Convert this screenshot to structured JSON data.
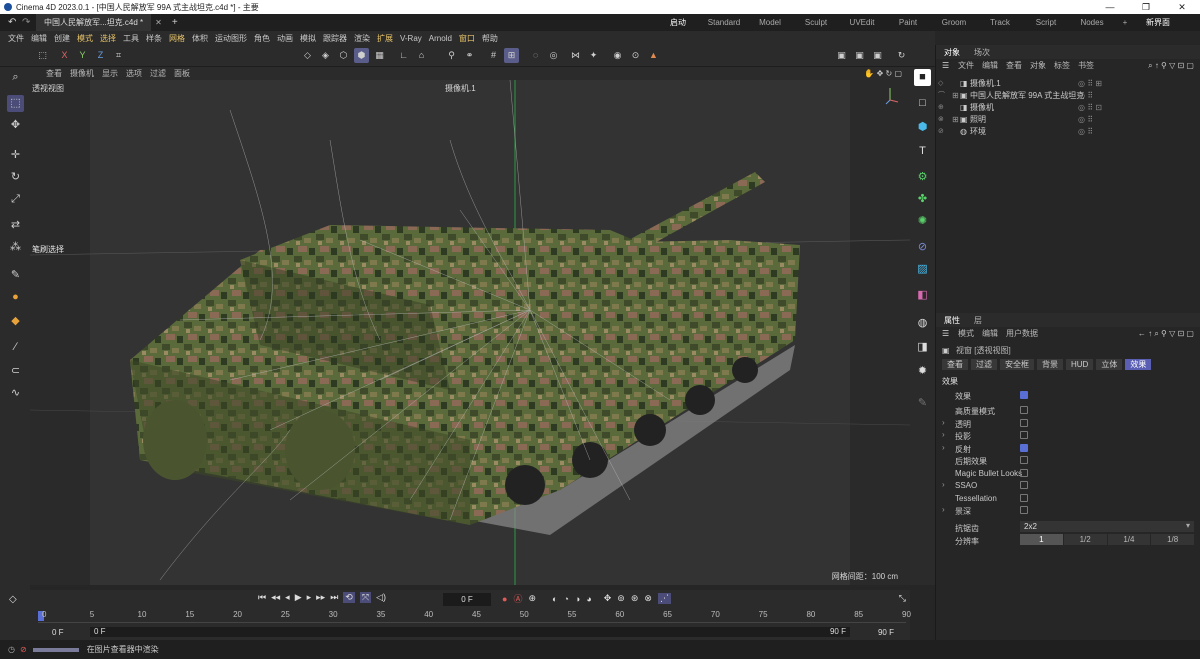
{
  "titlebar": {
    "title": "Cinema 4D 2023.0.1 - [中国人民解放军 99A 式主战坦克.c4d *] - 主要",
    "min": "—",
    "max": "❐",
    "close": "✕"
  },
  "tabs": {
    "doc": "中国人民解放军...坦克.c4d *",
    "add": "+"
  },
  "layouts": [
    "启动",
    "Standard",
    "Model",
    "Sculpt",
    "UVEdit",
    "Paint",
    "Groom",
    "Track",
    "Script",
    "Nodes",
    "+",
    "新界面"
  ],
  "menu": [
    "文件",
    "编辑",
    "创建",
    "模式",
    "选择",
    "工具",
    "样条",
    "网格",
    "体积",
    "运动图形",
    "角色",
    "动画",
    "模拟",
    "跟踪器",
    "渲染",
    "扩展",
    "V-Ray",
    "Arnold",
    "窗口",
    "帮助"
  ],
  "toolbar": {
    "xyz": [
      "X",
      "Y",
      "Z"
    ]
  },
  "viewport": {
    "menu": [
      "查看",
      "摄像机",
      "显示",
      "选项",
      "过滤",
      "面板"
    ],
    "label": "透视视图",
    "camera": "摄像机.1",
    "grid": "网格间距：100 cm",
    "brush_label": "笔刷选择"
  },
  "timeline": {
    "current": "0 F",
    "ticks": [
      "0",
      "5",
      "10",
      "15",
      "20",
      "25",
      "30",
      "35",
      "40",
      "45",
      "50",
      "55",
      "60",
      "65",
      "70",
      "75",
      "80",
      "85",
      "90"
    ],
    "start": "0 F",
    "start2": "0 F",
    "end": "90 F",
    "end2": "90 F"
  },
  "status": {
    "text": "在图片查看器中渲染"
  },
  "objects": {
    "tabs": [
      "对象",
      "场次"
    ],
    "menu": [
      "文件",
      "编辑",
      "查看",
      "对象",
      "标签",
      "书签"
    ],
    "items": [
      "摄像机.1",
      "中国人民解放军 99A 式主战坦克",
      "摄像机",
      "照明",
      "环境"
    ]
  },
  "attributes": {
    "tabs": [
      "属性",
      "层"
    ],
    "menu": [
      "模式",
      "编辑",
      "用户数据"
    ],
    "title": "视窗 [透视视图]",
    "subtabs": [
      "查看",
      "过滤",
      "安全框",
      "背景",
      "HUD",
      "立体",
      "效果"
    ],
    "section": "效果",
    "rows": [
      {
        "label": "效果",
        "checked": true,
        "arrow": ""
      },
      {
        "label": "高质量模式",
        "checked": false,
        "arrow": ""
      },
      {
        "label": "透明",
        "checked": false,
        "arrow": "›"
      },
      {
        "label": "投影",
        "checked": false,
        "arrow": "›"
      },
      {
        "label": "反射",
        "checked": true,
        "arrow": "›"
      },
      {
        "label": "后期效果",
        "checked": false,
        "arrow": ""
      },
      {
        "label": "Magic Bullet Looks",
        "checked": false,
        "arrow": ""
      },
      {
        "label": "SSAO",
        "checked": false,
        "arrow": "›"
      },
      {
        "label": "Tessellation",
        "checked": false,
        "arrow": ""
      },
      {
        "label": "景深",
        "checked": false,
        "arrow": "›"
      }
    ],
    "aa_label": "抗锯齿",
    "aa_value": "2x2",
    "res_label": "分辨率",
    "res_options": [
      "1",
      "1/2",
      "1/4",
      "1/8"
    ]
  }
}
